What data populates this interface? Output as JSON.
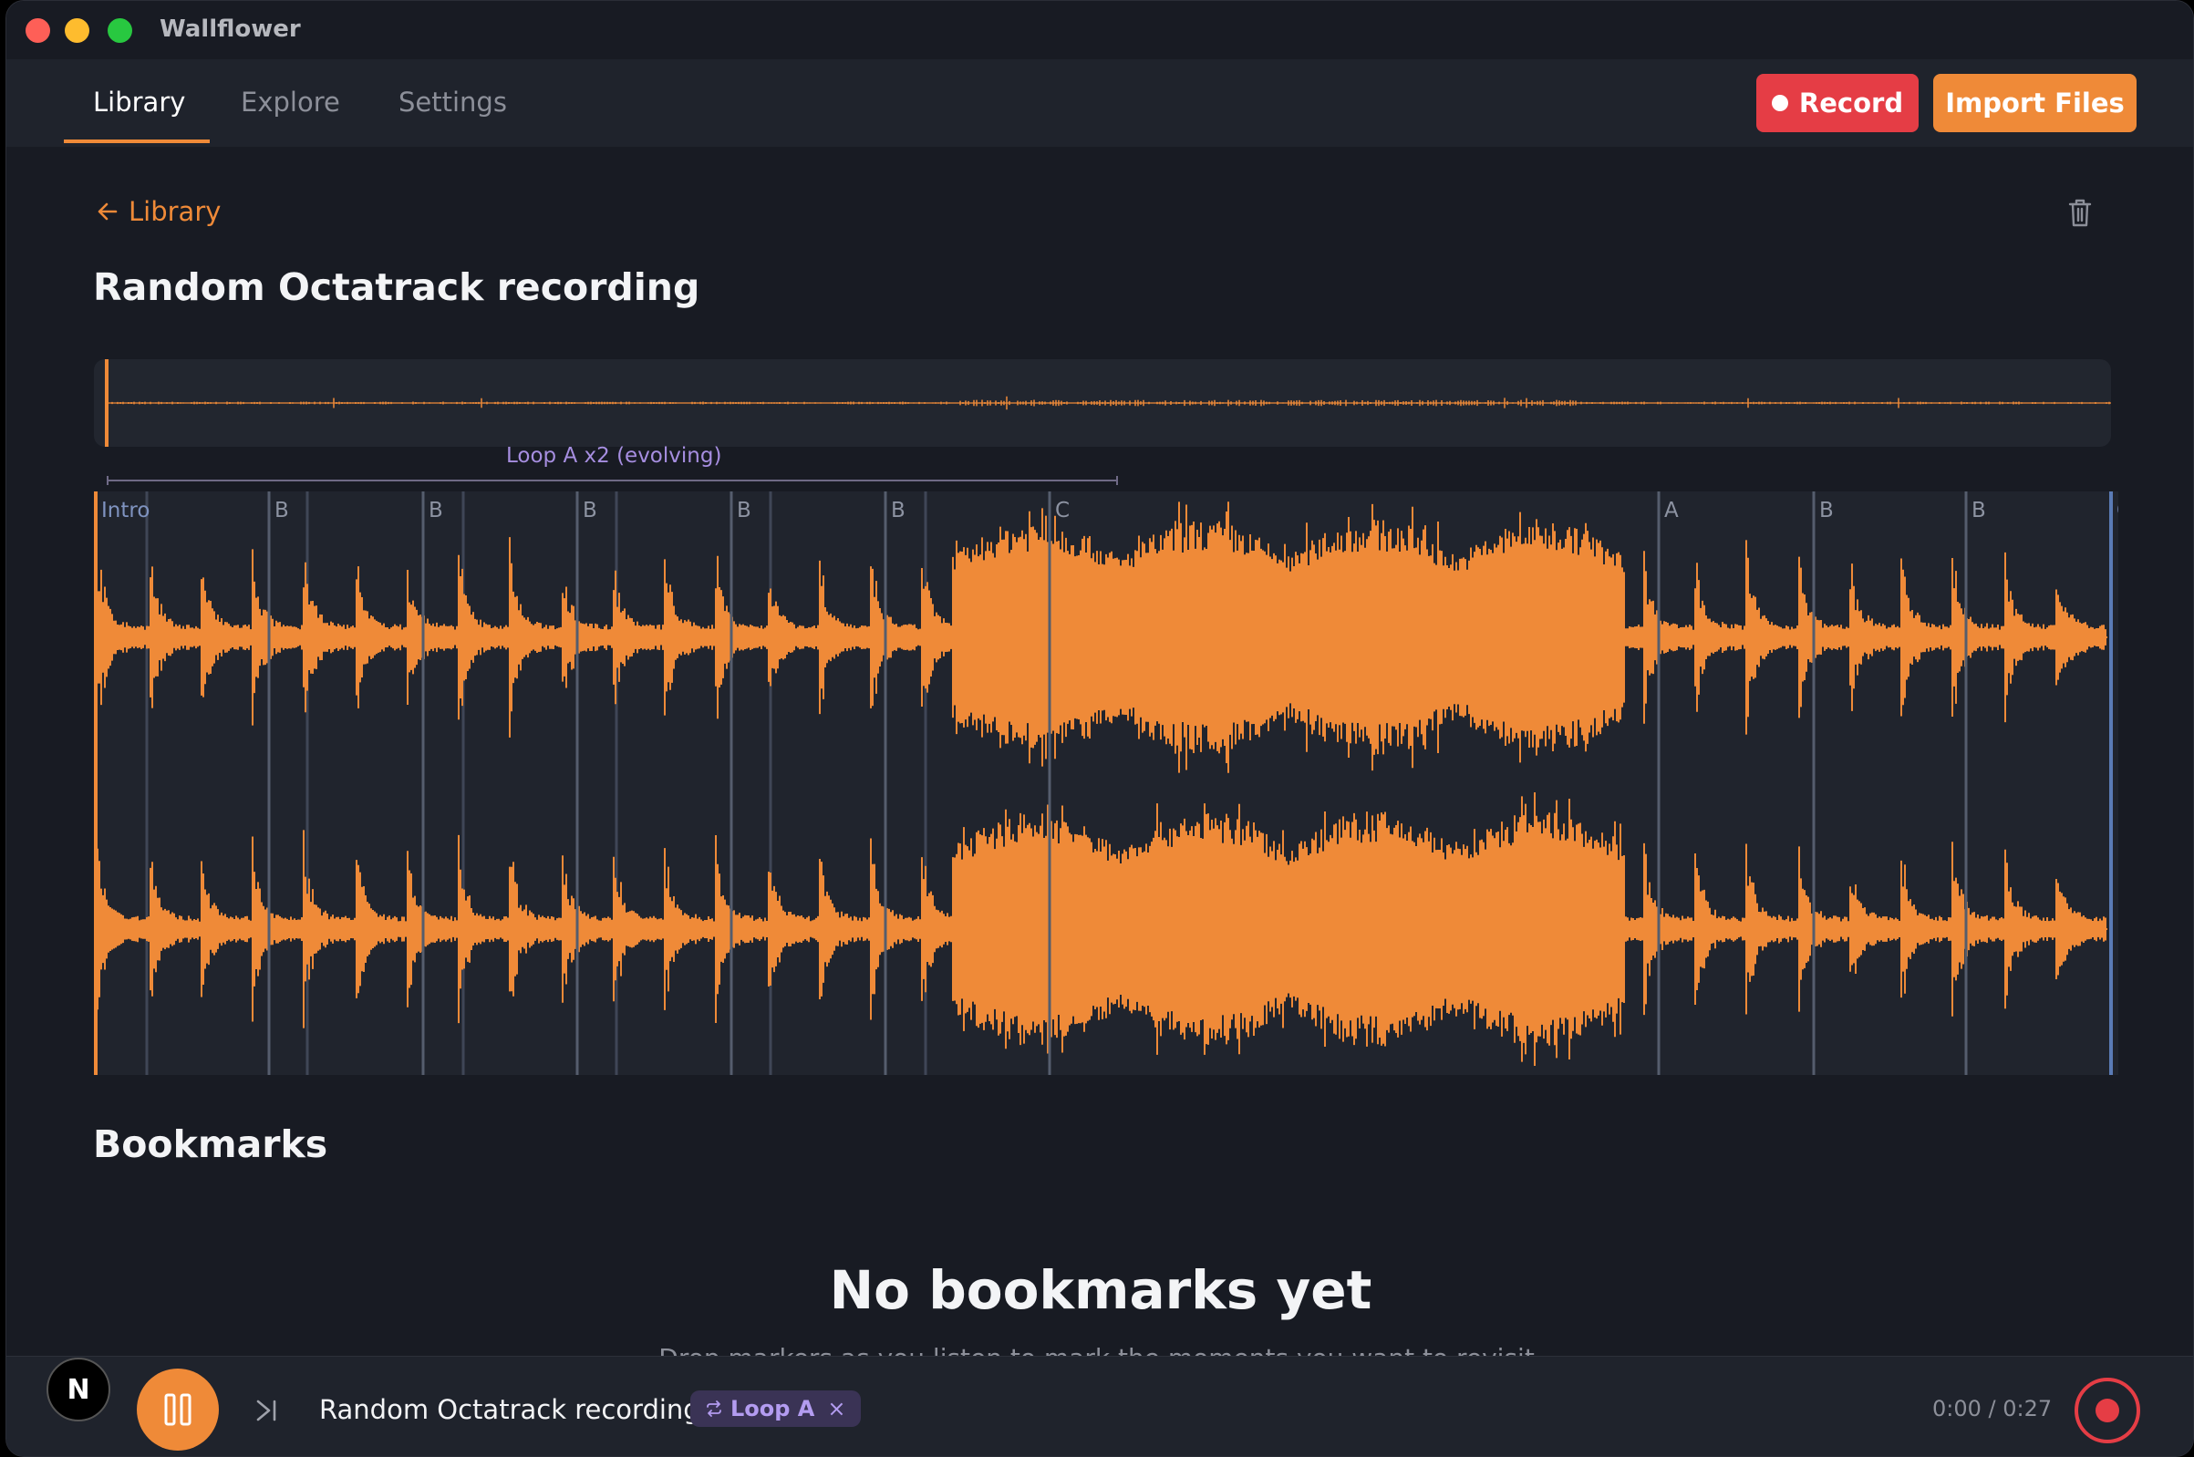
{
  "app": {
    "title": "Wallflower"
  },
  "nav": {
    "tabs": [
      {
        "label": "Library",
        "active": true
      },
      {
        "label": "Explore",
        "active": false
      },
      {
        "label": "Settings",
        "active": false
      }
    ],
    "record_label": "Record",
    "import_label": "Import Files"
  },
  "detail": {
    "back_label": "Library",
    "title": "Random Octatrack recording",
    "loop_label": "Loop A x2 (evolving)",
    "markers": [
      {
        "label": "Intro",
        "color": "#ef8a38"
      },
      {
        "label": "B"
      },
      {
        "label": "B"
      },
      {
        "label": "B"
      },
      {
        "label": "B"
      },
      {
        "label": "B"
      },
      {
        "label": "C"
      },
      {
        "label": "A"
      },
      {
        "label": "B"
      },
      {
        "label": "B"
      },
      {
        "label": "Outro",
        "color": "#5a7bb5"
      }
    ]
  },
  "bookmarks": {
    "title": "Bookmarks",
    "empty_title": "No bookmarks yet",
    "empty_subtitle": "Drop markers as you listen to mark the moments you want to revisit."
  },
  "player": {
    "badge": "N",
    "track_title": "Random Octatrack recording",
    "loop_chip": "Loop A",
    "loop_chip_close": "×",
    "time": "0:00 / 0:27"
  },
  "colors": {
    "accent": "#ef8a38",
    "record": "#e53d45",
    "loop": "#a68ee0",
    "bg": "#181b23"
  }
}
